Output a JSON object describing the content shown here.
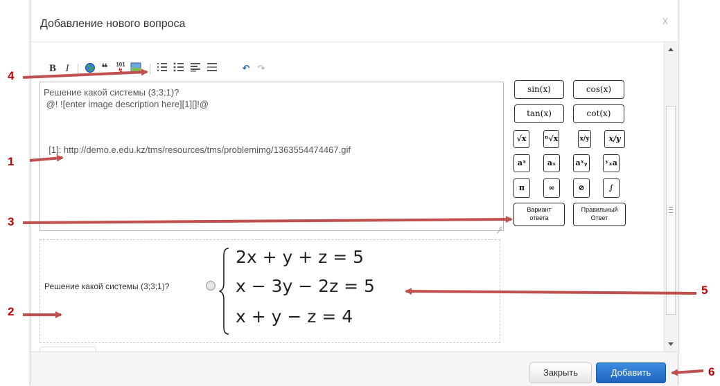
{
  "dialog": {
    "title": "Добавление нового вопроса",
    "close_glyph": "x"
  },
  "toolbar": {
    "bold": "B",
    "italic": "I",
    "link_icon": "globe-link-icon",
    "quote": "❝",
    "code": "101",
    "image_icon": "image-icon",
    "ordered_list_icon": "ordered-list-icon",
    "bullet_list_icon": "bullet-list-icon",
    "heading_icon": "heading-icon",
    "hr_icon": "horizontal-rule-icon",
    "undo": "↶",
    "redo": "↷"
  },
  "editor": {
    "line1": "Решение какой системы (3;3;1)?",
    "line2": " @! ![enter image description here][1][]!@",
    "line3": "  [1]: http://demo.e.edu.kz/tms/resources/tms/problemimg/1363554474467.gif"
  },
  "math_buttons": {
    "sin": "sin(x)",
    "cos": "cos(x)",
    "tan": "tan(x)",
    "cot": "cot(x)",
    "sqrt": "√x",
    "nroot": "ⁿ√x",
    "frac": "x/y",
    "xy": "x/y",
    "pow": "aˣ",
    "sub": "aₓ",
    "subsup": "aˣᵧ",
    "leftsub": "ʸₓa",
    "pi": "π",
    "inf": "∞",
    "empty": "⊘",
    "integral": "∫"
  },
  "answer_buttons": {
    "variant_line1": "Вариант",
    "variant_line2": "ответа",
    "correct_line1": "Правильный",
    "correct_line2": "Ответ"
  },
  "preview": {
    "question": "Решение какой системы (3;3;1)?",
    "eq1": "2x + y + z = 5",
    "eq2": "x − 3y − 2z = 5",
    "eq3": "x + y − z = 4"
  },
  "footer": {
    "close_label": "Закрыть",
    "add_label": "Добавить"
  },
  "annotations": {
    "n1": "1",
    "n2": "2",
    "n3": "3",
    "n4": "4",
    "n5": "5",
    "n6": "6",
    "color": "#c0504d"
  }
}
